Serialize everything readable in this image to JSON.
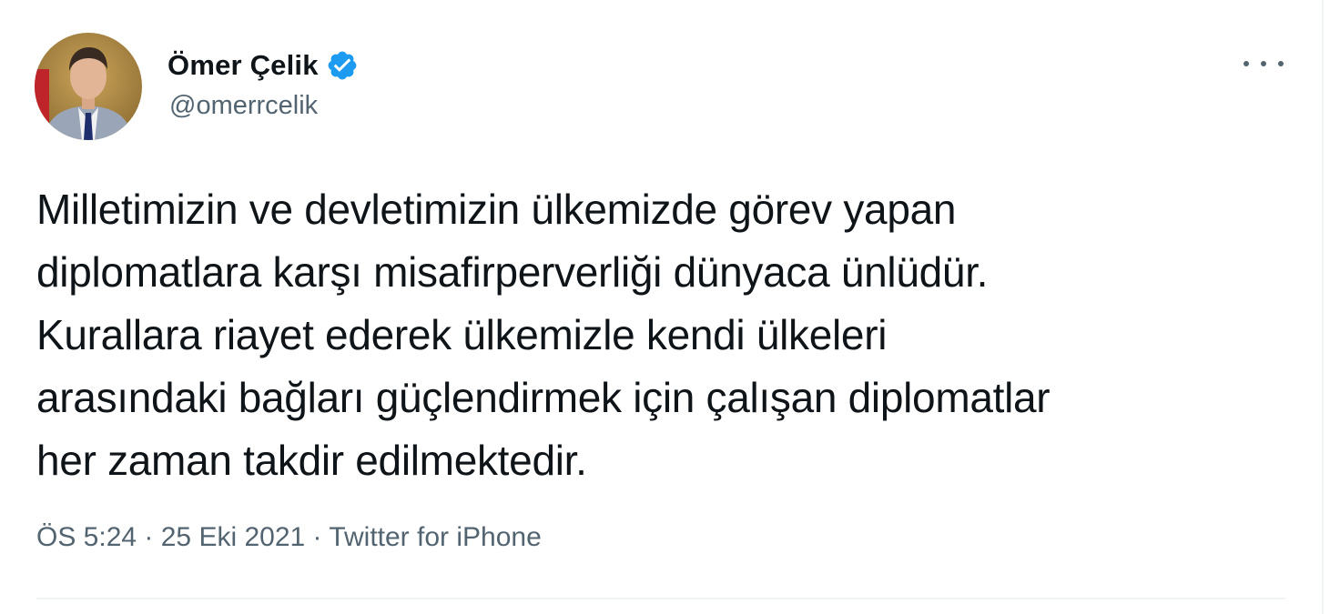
{
  "author": {
    "display_name": "Ömer Çelik",
    "handle": "@omerrcelik",
    "verified": true
  },
  "tweet": {
    "text_lines": [
      "Milletimizin ve devletimizin ülkemizde görev yapan",
      "diplomatlara karşı misafirperverliği dünyaca ünlüdür.",
      "Kurallara riayet ederek ülkemizle kendi ülkeleri",
      "arasındaki bağları güçlendirmek için çalışan diplomatlar",
      "her zaman takdir edilmektedir."
    ],
    "time": "ÖS 5:24",
    "separator": " · ",
    "date": "25 Eki 2021",
    "source": "Twitter for iPhone"
  },
  "icons": {
    "verified": "verified-badge-icon",
    "more": "more-horizontal-icon"
  },
  "colors": {
    "text_primary": "#0f1419",
    "text_secondary": "#536471",
    "verified_blue": "#1d9bf0",
    "divider": "#eff3f4"
  }
}
